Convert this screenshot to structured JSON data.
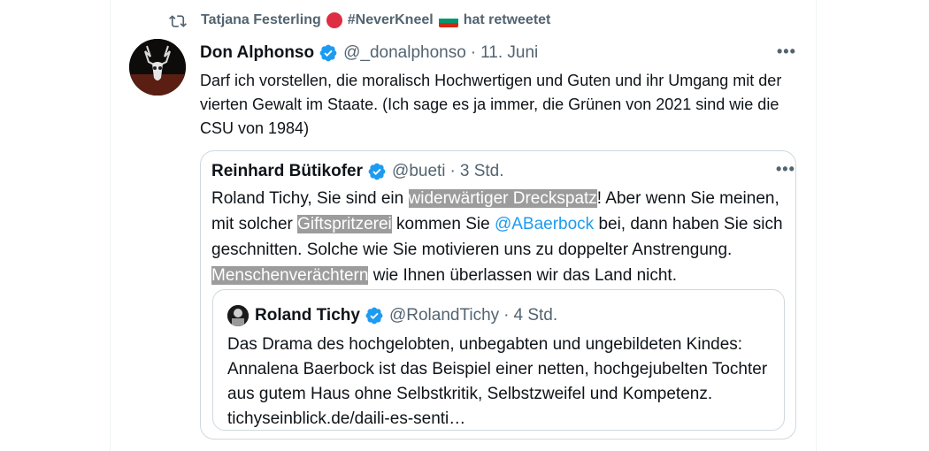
{
  "retweet": {
    "user": "Tatjana Festerling",
    "hashtag": "#NeverKneel",
    "action": "hat retweetet",
    "icon": "retweet-icon"
  },
  "tweet": {
    "author_name": "Don Alphonso",
    "handle": "@_donalphonso",
    "separator": "·",
    "date": "11. Juni",
    "more_label": "•••",
    "text": "Darf ich vorstellen, die moralisch Hochwertigen und Guten und ihr Umgang mit der vierten Gewalt im Staate. (Ich sage es ja immer, die Grünen von 2021 sind wie die CSU von 1984)"
  },
  "quote": {
    "author_name": "Reinhard Bütikofer",
    "handle": "@bueti",
    "separator": "·",
    "time": "3 Std.",
    "more_label": "•••",
    "segments": [
      "Roland Tichy, Sie sind ein ",
      "widerwärtiger Dreckspatz",
      "! Aber wenn Sie meinen, mit solcher ",
      "Giftspritzerei",
      " kommen Sie ",
      "@ABaerbock",
      " bei, dann haben Sie sich geschnitten. Solche wie Sie motivieren uns zu doppelter Anstrengung. ",
      "Menschenverächtern",
      " wie Ihnen überlassen wir das Land nicht."
    ]
  },
  "inner_quote": {
    "author_name": "Roland Tichy",
    "handle": "@RolandTichy",
    "separator": "·",
    "time": "4 Std.",
    "text": "Das Drama des hochgelobten, unbegabten und ungebildeten Kindes: Annalena Baerbock ist das Beispiel einer netten, hochgejubelten Tochter aus gutem Haus ohne Selbstkritik, Selbstzweifel und Kompetenz.",
    "link": "tichyseinblick.de/daili-es-senti…"
  },
  "colors": {
    "verified": "#1d9bf0",
    "secondary_text": "#536471",
    "highlight": "#9c9c9c",
    "mention": "#1d9bf0",
    "border": "#cfd9de"
  }
}
